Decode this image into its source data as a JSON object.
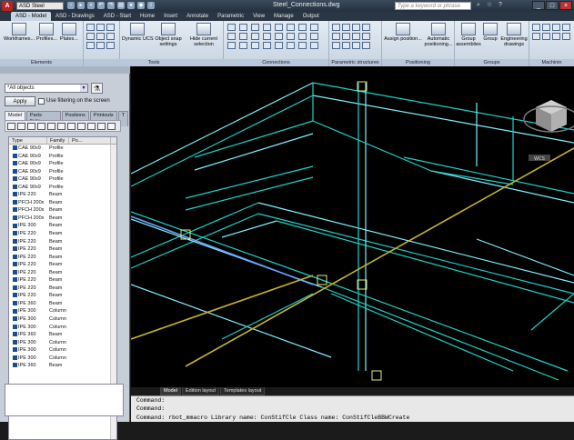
{
  "app": {
    "logo": "A",
    "workspace": "ASD Steel",
    "document_title": "Steel_Connections.dwg",
    "search_placeholder": "Type a keyword or phrase"
  },
  "window_controls": [
    "_",
    "□",
    "×"
  ],
  "tabs": [
    "Home",
    "ASD - Model",
    "ASD - Drawings",
    "ASD - Start",
    "Home",
    "Insert",
    "Annotate",
    "Parametric",
    "View",
    "Manage",
    "Output"
  ],
  "ribbon": {
    "elements": {
      "title": "Elements",
      "buttons": [
        "Workframes...",
        "Profiles...",
        "Plates..."
      ]
    },
    "tools": {
      "title": "Tools",
      "buttons": [
        "Dynamic UCS",
        "Object snap settings",
        "Hide current selection"
      ]
    },
    "connections": {
      "title": "Connections"
    },
    "parametric": {
      "title": "Parametric structures"
    },
    "positioning": {
      "title": "Positioning",
      "buttons": [
        "Assign position...",
        "Automatic positioning..."
      ]
    },
    "groups": {
      "title": "Groups",
      "buttons": [
        "Group assemblies",
        "Group",
        "Engineering drawings"
      ]
    },
    "machining": {
      "title": "Machinin"
    }
  },
  "left_panel": {
    "filter_value": "*All objects",
    "apply_label": "Apply",
    "filter_checkbox_label": "Use filtering on the screen",
    "panel_tabs": [
      "Model",
      "Parts Edition",
      "Positions",
      "Printouts",
      "T"
    ],
    "columns": [
      "Type",
      "Family",
      "Po..."
    ],
    "rows": [
      [
        "CAE 90x9",
        "Profile"
      ],
      [
        "CAE 90x9",
        "Profile"
      ],
      [
        "CAE 90x9",
        "Profile"
      ],
      [
        "CAE 90x9",
        "Profile"
      ],
      [
        "CAE 90x9",
        "Profile"
      ],
      [
        "CAE 90x9",
        "Profile"
      ],
      [
        "IPE 220",
        "Beam"
      ],
      [
        "PFCH 200x",
        "Beam"
      ],
      [
        "PFCH 200x",
        "Beam"
      ],
      [
        "PFCH 200x",
        "Beam"
      ],
      [
        "IPE 300",
        "Beam"
      ],
      [
        "IPE 220",
        "Beam"
      ],
      [
        "IPE 220",
        "Beam"
      ],
      [
        "IPE 220",
        "Beam"
      ],
      [
        "IPE 220",
        "Beam"
      ],
      [
        "IPE 220",
        "Beam"
      ],
      [
        "IPE 220",
        "Beam"
      ],
      [
        "IPE 220",
        "Beam"
      ],
      [
        "IPE 220",
        "Beam"
      ],
      [
        "IPE 220",
        "Beam"
      ],
      [
        "IPE 360",
        "Beam"
      ],
      [
        "IPE 300",
        "Column"
      ],
      [
        "IPE 300",
        "Column"
      ],
      [
        "IPE 300",
        "Column"
      ],
      [
        "IPE 360",
        "Beam"
      ],
      [
        "IPE 300",
        "Column"
      ],
      [
        "IPE 300",
        "Column"
      ],
      [
        "IPE 300",
        "Column"
      ],
      [
        "IPE 360",
        "Beam"
      ]
    ]
  },
  "viewport": {
    "viewcube_label": "WCS",
    "colors": {
      "beam": "#1fd1c8",
      "beam_inner": "#7ef0ff",
      "accent": "#6fa0ff",
      "axis_yellow": "#c8b428",
      "node": "#e6e68a"
    }
  },
  "layout_tabs": [
    "Model",
    "Edition layout",
    "Templates layout"
  ],
  "command_lines": [
    "Command:",
    "Command:",
    "Command: rbot_mmacro Library name: ConStifCle Class name: ConStifCleBBWCreate"
  ]
}
